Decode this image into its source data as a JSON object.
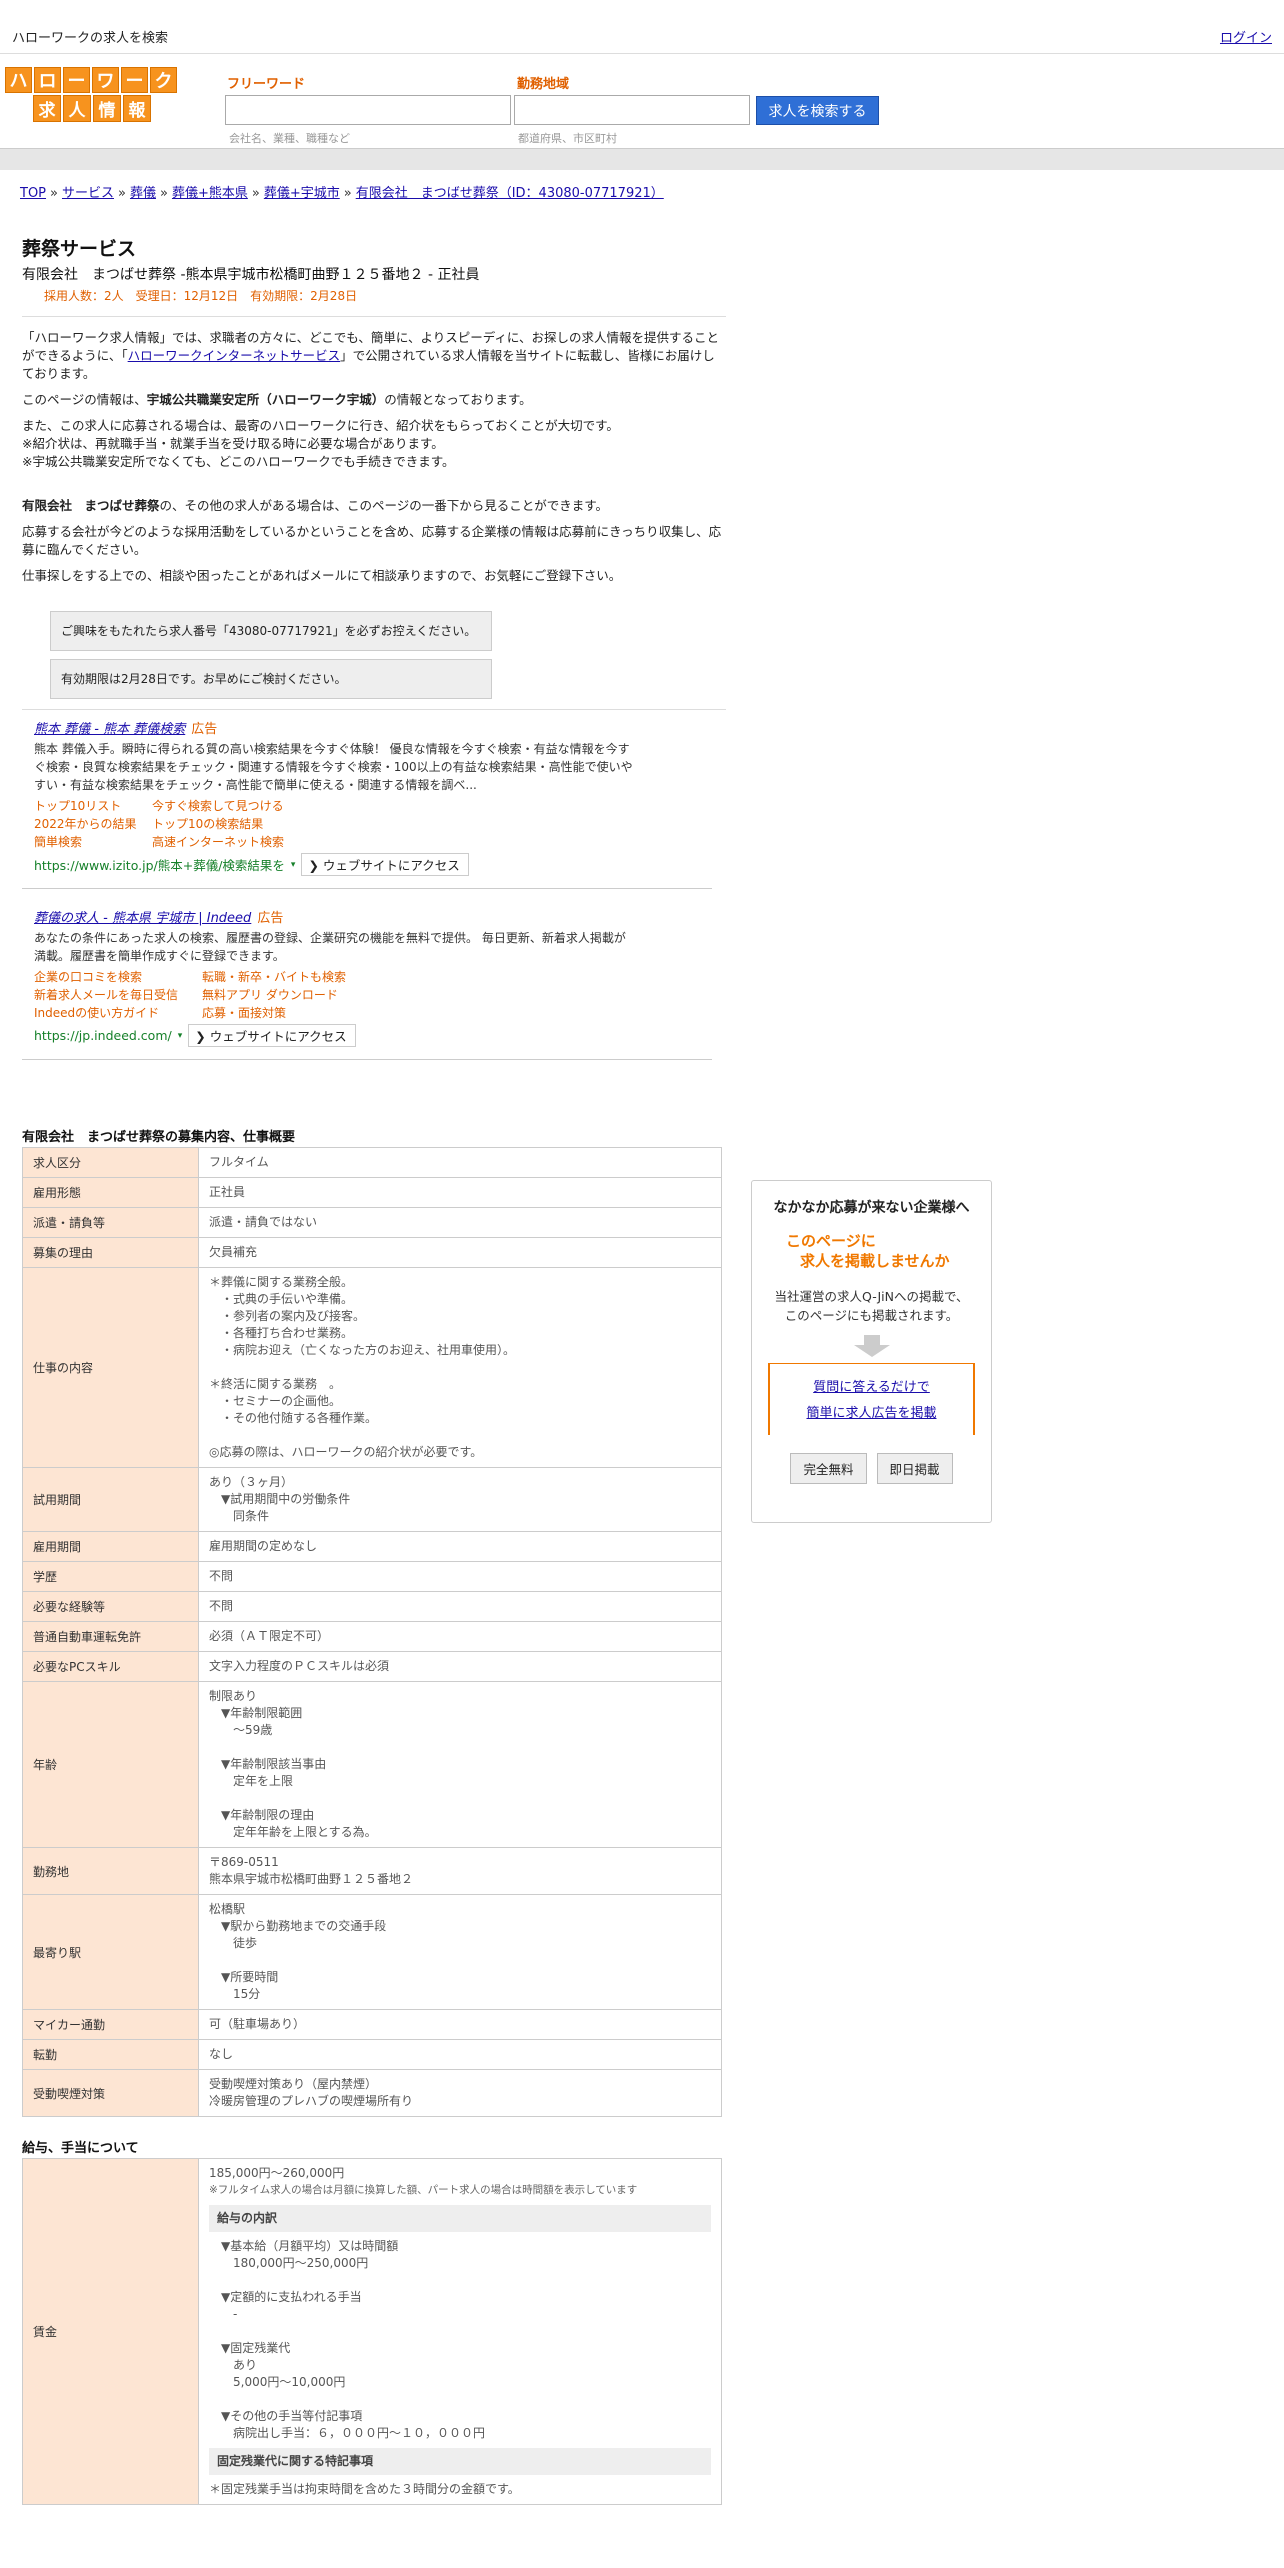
{
  "topbar": {
    "site_title": "ハローワークの求人を検索",
    "login": "ログイン"
  },
  "logo": {
    "row1": [
      "ハ",
      "ロ",
      "ー",
      "ワ",
      "ー",
      "ク"
    ],
    "row2": [
      "求",
      "人",
      "情",
      "報"
    ]
  },
  "search": {
    "free_label": "フリーワード",
    "free_hint": "会社名、業種、職種など",
    "area_label": "勤務地域",
    "area_hint": "都道府県、市区町村",
    "button": "求人を検索する"
  },
  "breadcrumb": [
    "TOP",
    "サービス",
    "葬儀",
    "葬儀+熊本県",
    "葬儀+宇城市",
    "有限会社　まつばせ葬祭（ID：43080-07717921）"
  ],
  "breadcrumb_sep": "»",
  "job": {
    "title": "葬祭サービス",
    "company_line": "有限会社　まつばせ葬祭 -熊本県宇城市松橋町曲野１２５番地２ - 正社員",
    "meta": "採用人数：2人　受理日：12月12日　有効期限：2月28日"
  },
  "intro": {
    "p1_a": "「ハローワーク求人情報」では、求職者の方々に、どこでも、簡単に、よりスピーディに、お探しの求人情報を提供することができるように、「",
    "p1_link": "ハローワークインターネットサービス",
    "p1_b": "」で公開されている求人情報を当サイトに転載し、皆様にお届けしております。",
    "p2_a": "このページの情報は、",
    "p2_b": "宇城公共職業安定所（ハローワーク宇城）",
    "p2_c": "の情報となっております。",
    "p3": "また、この求人に応募される場合は、最寄のハローワークに行き、紹介状をもらっておくことが大切です。\n※紹介状は、再就職手当・就業手当を受け取る時に必要な場合があります。\n※宇城公共職業安定所でなくても、どこのハローワークでも手続きできます。",
    "p4_a": "有限会社　まつばせ葬祭",
    "p4_b": "の、その他の求人がある場合は、このページの一番下から見ることができます。",
    "p5": "応募する会社が今どのような採用活動をしているかということを含め、応募する企業様の情報は応募前にきっちり収集し、応募に臨んでください。",
    "p6": "仕事探しをする上での、相談や困ったことがあればメールにて相談承りますので、お気軽にご登録下さい。"
  },
  "notices": [
    "ご興味をもたれたら求人番号「43080-07717921」を必ずお控えください。",
    "有効期限は2月28日です。お早めにご検討ください。"
  ],
  "ads": [
    {
      "title": "熊本 葬儀 - 熊本 葬儀検索",
      "label": "広告",
      "desc": "熊本 葬儀入手。瞬時に得られる質の高い検索結果を今すぐ体験！ 優良な情報を今すぐ検索・有益な情報を今すぐ検索・良質な検索結果をチェック・関連する情報を今すぐ検索・100以上の有益な検索結果・高性能で使いやすい・有益な検索結果をチェック・高性能で簡単に使える・関連する情報を調べ...",
      "links": [
        "トップ10リスト",
        "今すぐ検索して見つける",
        "2022年からの結果",
        "トップ10の検索結果",
        "簡単検索",
        "高速インターネット検索"
      ],
      "url": "https://www.izito.jp/熊本+葬儀/検索結果を",
      "visit": "ウェブサイトにアクセス"
    },
    {
      "title": "葬儀の求人 - 熊本県 宇城市 | Indeed",
      "label": "広告",
      "desc": "あなたの条件にあった求人の検索、履歴書の登録、企業研究の機能を無料で提供。 毎日更新、新着求人掲載が満載。履歴書を簡単作成すぐに登録できます。",
      "links": [
        "企業の口コミを検索",
        "転職・新卒・バイトも検索",
        "新着求人メールを毎日受信",
        "無料アプリ ダウンロード",
        "Indeedの使い方ガイド",
        "応募・面接対策"
      ],
      "url": "https://jp.indeed.com/",
      "visit": "ウェブサイトにアクセス"
    }
  ],
  "details": {
    "section_title": "有限会社　まつばせ葬祭の募集内容、仕事概要",
    "rows": [
      {
        "label": "求人区分",
        "value": "フルタイム"
      },
      {
        "label": "雇用形態",
        "value": "正社員"
      },
      {
        "label": "派遣・請負等",
        "value": "派遣・請負ではない"
      },
      {
        "label": "募集の理由",
        "value": "欠員補充"
      },
      {
        "label": "仕事の内容",
        "value": "＊葬儀に関する業務全般。\n　・式典の手伝いや準備。\n　・参列者の案内及び接客。\n　・各種打ち合わせ業務。\n　・病院お迎え（亡くなった方のお迎え、社用車使用）。\n\n＊終活に関する業務　。\n　・セミナーの企画他。\n　・その他付随する各種作業。\n\n◎応募の際は、ハローワークの紹介状が必要です。"
      },
      {
        "label": "試用期間",
        "value": "あり（３ヶ月）\n　▼試用期間中の労働条件\n　　同条件"
      },
      {
        "label": "雇用期間",
        "value": "雇用期間の定めなし"
      },
      {
        "label": "学歴",
        "value": "不問"
      },
      {
        "label": "必要な経験等",
        "value": "不問"
      },
      {
        "label": "普通自動車運転免許",
        "value": "必須（ＡＴ限定不可）"
      },
      {
        "label": "必要なPCスキル",
        "value": "文字入力程度のＰＣスキルは必須"
      },
      {
        "label": "年齢",
        "value": "制限あり\n　▼年齢制限範囲\n　　〜59歳\n\n　▼年齢制限該当事由\n　　定年を上限\n\n　▼年齢制限の理由\n　　定年年齢を上限とする為。"
      },
      {
        "label": "勤務地",
        "value": "〒869-0511\n熊本県宇城市松橋町曲野１２５番地２"
      },
      {
        "label": "最寄り駅",
        "value": "松橋駅\n　▼駅から勤務地までの交通手段\n　　徒歩\n\n　▼所要時間\n　　15分"
      },
      {
        "label": "マイカー通勤",
        "value": "可（駐車場あり）"
      },
      {
        "label": "転勤",
        "value": "なし"
      },
      {
        "label": "受動喫煙対策",
        "value": "受動喫煙対策あり（屋内禁煙）\n冷暖房管理のプレハブの喫煙場所有り"
      }
    ]
  },
  "salary": {
    "section_title": "給与、手当について",
    "label": "賃金",
    "range": "185,000円〜260,000円",
    "note": "※フルタイム求人の場合は月額に換算した額、パート求人の場合は時間額を表示しています",
    "breakdown_title": "給与の内訳",
    "breakdown": "　▼基本給（月額平均）又は時間額\n　　180,000円〜250,000円\n\n　▼定額的に支払われる手当\n　　-\n\n　▼固定残業代\n　　あり\n　　5,000円〜10,000円\n\n　▼その他の手当等付記事項\n　　病院出し手当：６，０００円～１０，０００円",
    "fixed_title": "固定残業代に関する特記事項",
    "fixed_text": "＊固定残業手当は拘束時間を含めた３時間分の金額です。"
  },
  "side": {
    "title": "なかなか応募が来ない企業様へ",
    "catch_1": "このページに",
    "catch_2": "求人を掲載しませんか",
    "body": "当社運営の求人Q-JiNへの掲載で、\nこのページにも掲載されます。",
    "link_1": "質問に答えるだけで",
    "link_2": "簡単に求人広告を掲載",
    "badge_1": "完全無料",
    "badge_2": "即日掲載"
  }
}
